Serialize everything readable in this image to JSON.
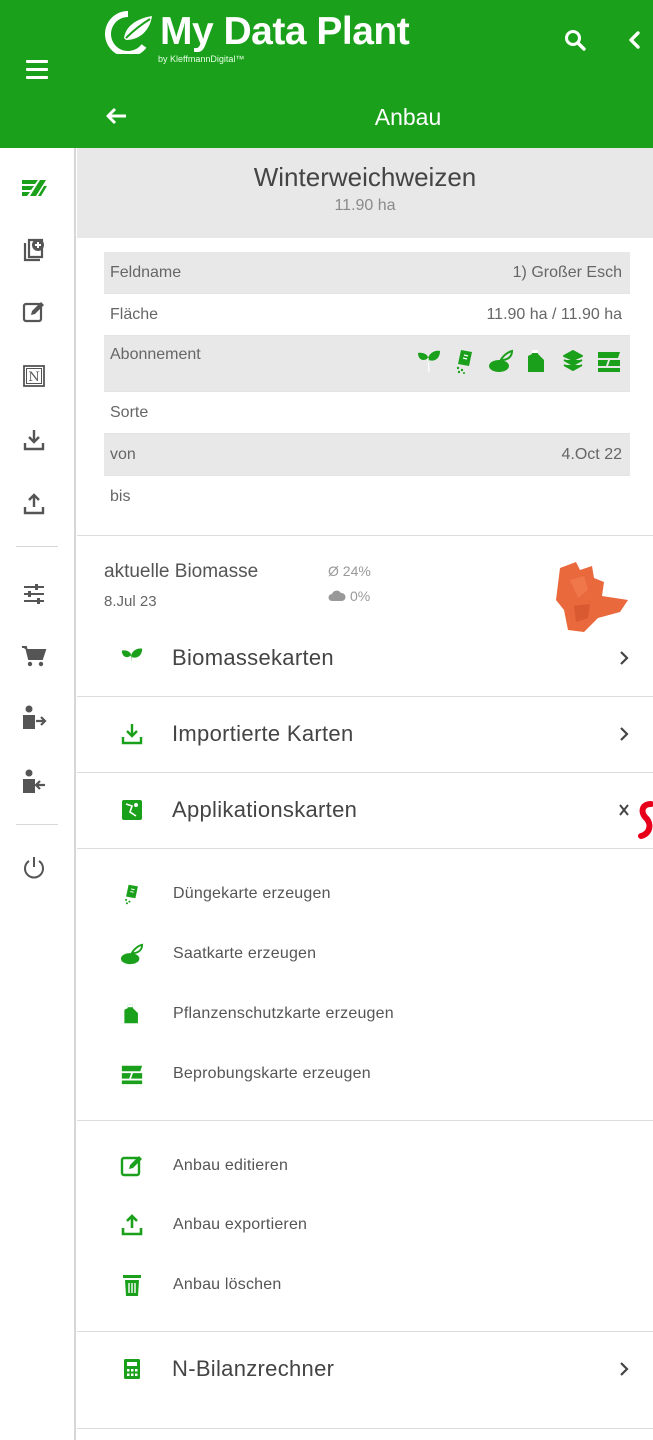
{
  "header": {
    "app_name": "My Data Plant",
    "app_subtitle": "by KleffmannDigital™",
    "page_title": "Anbau",
    "colors": {
      "brand": "#1aa01a",
      "text_on_brand": "#ffffff"
    },
    "icons": [
      "menu-icon",
      "search-icon",
      "chevron-left-icon",
      "arrow-left-icon"
    ]
  },
  "sidebar": {
    "icons": [
      "fields-icon",
      "add-document-icon",
      "edit-icon",
      "n-box-icon",
      "download-icon",
      "upload-icon",
      "sliders-icon",
      "cart-icon",
      "user-logout-icon",
      "user-login-icon",
      "power-icon"
    ]
  },
  "crop": {
    "name": "Winterweichweizen",
    "area": "11.90 ha"
  },
  "info": {
    "feldname_label": "Feldname",
    "feldname_value": "1) Großer Esch",
    "flaeche_label": "Fläche",
    "flaeche_value": "11.90 ha / 11.90 ha",
    "abonnement_label": "Abonnement",
    "sorte_label": "Sorte",
    "sorte_value": "",
    "von_label": "von",
    "von_value": "4.Oct 22",
    "bis_label": "bis",
    "bis_value": ""
  },
  "biomass": {
    "label": "aktuelle Biomasse",
    "date": "8.Jul 23",
    "avg": "Ø 24%",
    "cloud": "0%"
  },
  "menu": {
    "biomassekarten": "Biomassekarten",
    "importierte_karten": "Importierte Karten",
    "applikationskarten": "Applikationskarten",
    "n_bilanzrechner": "N-Bilanzrechner"
  },
  "create_actions": {
    "duenge": "Düngekarte erzeugen",
    "saat": "Saatkarte erzeugen",
    "pflanzenschutz": "Pflanzenschutzkarte erzeugen",
    "beprobung": "Beprobungskarte erzeugen"
  },
  "crop_actions": {
    "edit": "Anbau editieren",
    "export": "Anbau exportieren",
    "delete": "Anbau löschen"
  }
}
